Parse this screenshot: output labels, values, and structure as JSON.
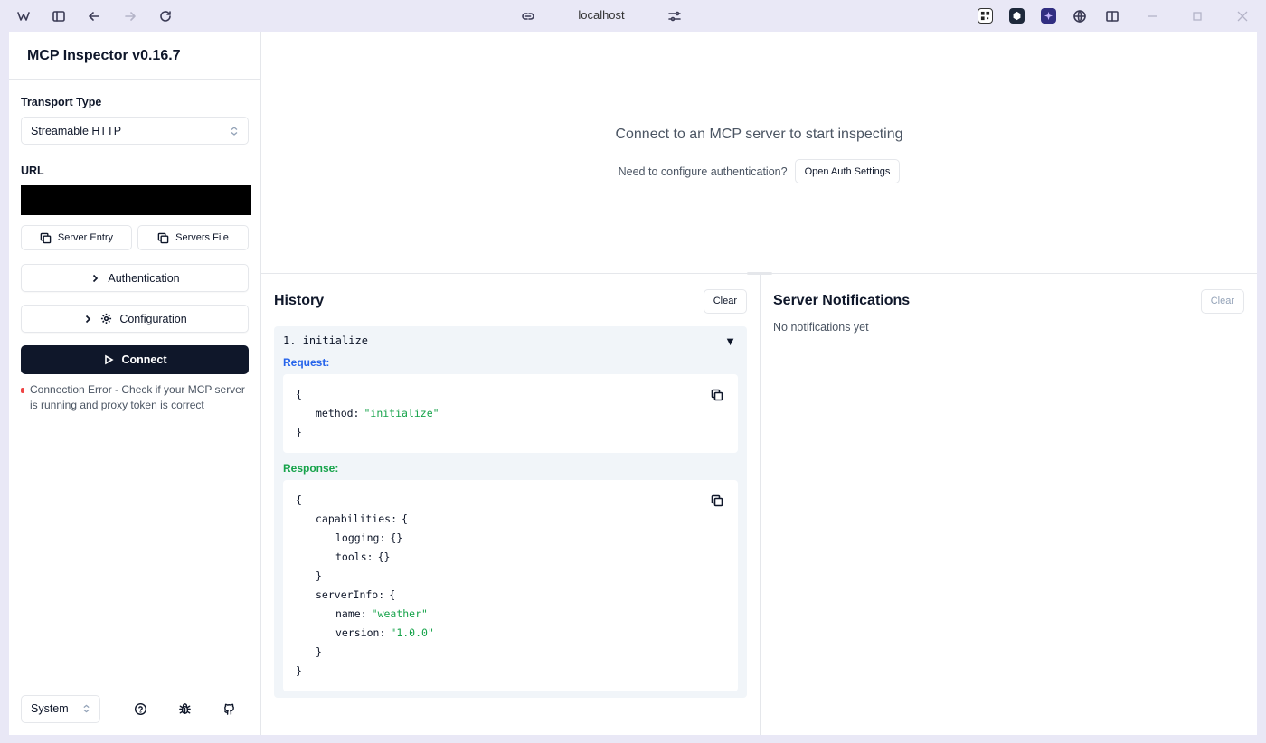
{
  "browser": {
    "url": "localhost"
  },
  "sidebar": {
    "title": "MCP Inspector v0.16.7",
    "transport_label": "Transport Type",
    "transport_value": "Streamable HTTP",
    "url_label": "URL",
    "server_entry_label": "Server Entry",
    "servers_file_label": "Servers File",
    "authentication_label": "Authentication",
    "configuration_label": "Configuration",
    "connect_label": "Connect",
    "error_text": "Connection Error - Check if your MCP server is running and proxy token is correct",
    "error_color": "#ef4444",
    "theme_value": "System"
  },
  "top_pane": {
    "message": "Connect to an MCP server to start inspecting",
    "auth_question": "Need to configure authentication?",
    "auth_button": "Open Auth Settings"
  },
  "history": {
    "title": "History",
    "clear_label": "Clear",
    "entries": [
      {
        "title": "1. initialize",
        "request_label": "Request:",
        "response_label": "Response:",
        "request": {
          "method_key": "method",
          "method_value": "\"initialize\""
        },
        "response": {
          "capabilities_key": "capabilities",
          "logging_key": "logging",
          "tools_key": "tools",
          "serverinfo_key": "serverInfo",
          "name_key": "name",
          "name_value": "\"weather\"",
          "version_key": "version",
          "version_value": "\"1.0.0\""
        }
      }
    ]
  },
  "notifications": {
    "title": "Server Notifications",
    "clear_label": "Clear",
    "empty_text": "No notifications yet"
  },
  "colors": {
    "accent_dark": "#0f172a",
    "request_label": "#2563eb",
    "response_label": "#16a34a"
  }
}
